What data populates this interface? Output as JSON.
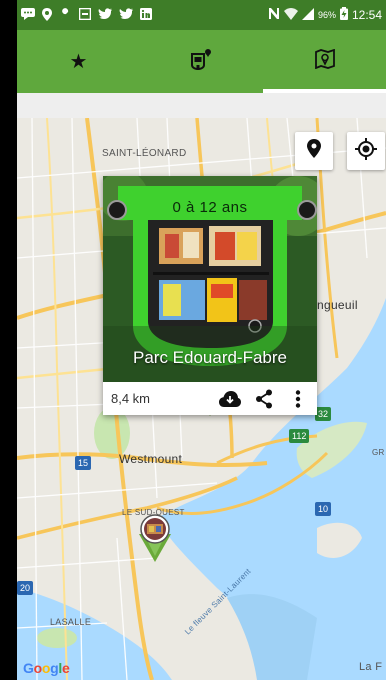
{
  "status_bar": {
    "icons": [
      "messages-icon",
      "location-icon",
      "wrench-icon",
      "box-icon",
      "twitter-icon",
      "twitter-icon",
      "linkedin-icon"
    ],
    "nfc_icon": "nfc-icon",
    "wifi_icon": "wifi-icon",
    "signal_icon": "signal-icon",
    "battery_pct": "96%",
    "battery_icon": "battery-charging-icon",
    "time": "12:54"
  },
  "tabs": [
    {
      "name": "favorites",
      "icon": "star-icon",
      "glyph": "★",
      "active": false
    },
    {
      "name": "bookbox",
      "icon": "bookbox-pin-icon",
      "glyph": "",
      "active": false
    },
    {
      "name": "map",
      "icon": "map-icon",
      "glyph": "",
      "active": true
    }
  ],
  "map": {
    "labels": {
      "saint_leonard": "SAINT-LÉONARD",
      "longueuil": "ngueuil",
      "westmount": "Westmount",
      "le_sud_ouest": "LE SUD-OUEST",
      "lasalle": "LASALLE",
      "river": "Le fleuve Saint-Laurent",
      "la_f": "La F",
      "gr": "GR"
    },
    "shields": {
      "r32": "32",
      "r112": "112",
      "r15": "15",
      "r10": "10",
      "r20": "20"
    },
    "google": [
      "G",
      "o",
      "o",
      "g",
      "l",
      "e"
    ],
    "marker_color": "#6aaa3a"
  },
  "info_card": {
    "sign_text": "0 à 12 ans",
    "title": "Parc Edouard-Fabre",
    "distance": "8,4 km",
    "actions": [
      "cloud-download-icon",
      "share-icon",
      "more-vert-icon"
    ]
  },
  "colors": {
    "status_bar": "#3e7d28",
    "tab_bar": "#5fa83d",
    "accent_green": "#3fbf2e",
    "water": "#aadaff",
    "park": "#c8e6b0",
    "road": "#f7c65a"
  }
}
